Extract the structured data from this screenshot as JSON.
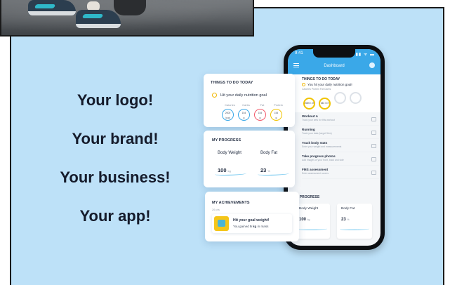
{
  "slogans": [
    "Your logo!",
    "Your brand!",
    "Your business!",
    "Your app!"
  ],
  "phone": {
    "time": "9:41",
    "status": "▮▮ ᯤ ▬",
    "title": "Dashboard",
    "todo": {
      "heading": "THINGS TO DO TODAY",
      "goal": "You hit your daily nutrition goal!",
      "legend": "Calories   Protein   Fat   Carbs",
      "rings": [
        "2000 / 47",
        "154 / 47",
        "",
        ""
      ]
    },
    "items": [
      {
        "title": "Workout A",
        "sub": "Track your sets for this workout"
      },
      {
        "title": "Running",
        "sub": "Track your data (target 5km)"
      },
      {
        "title": "Track body stats",
        "sub": "Enter your weight and measurements"
      },
      {
        "title": "Take progress photos",
        "sub": "Add images of your front, back and side"
      },
      {
        "title": "FMS assessment",
        "sub": "Enter assessment scores"
      }
    ],
    "progress_heading": "MY PROGRESS",
    "cards": [
      {
        "label": "Body Weight",
        "value": "100",
        "unit": "kg"
      },
      {
        "label": "Body Fat",
        "value": "23",
        "unit": "%"
      }
    ]
  },
  "todo_card": {
    "heading": "THINGS TO DO TODAY",
    "goal": "Hit your daily nutrition goal",
    "legend": [
      "Calories",
      "Carbs",
      "Fat",
      "Protein"
    ],
    "rings": [
      {
        "top": "2000",
        "bottom": "kcal"
      },
      {
        "top": "154",
        "bottom": "g"
      },
      {
        "top": "154",
        "bottom": "g"
      },
      {
        "top": "154",
        "bottom": "g"
      }
    ]
  },
  "progress_card": {
    "heading": "MY PROGRESS",
    "cards": [
      {
        "label": "Body Weight",
        "value": "100",
        "unit": "kg"
      },
      {
        "label": "Body Fat",
        "value": "23",
        "unit": "%"
      }
    ]
  },
  "achievements_card": {
    "heading": "MY ACHIEVEMENTS",
    "sub": "26 pts",
    "title": "Hit your goal weight!",
    "desc_pre": "You gained ",
    "desc_bold": "5 kg",
    "desc_post": " in mass"
  },
  "colors": {
    "panel_bg": "#bde1f8",
    "accent_blue": "#3aa8e8",
    "accent_yellow": "#f1c400",
    "accent_red": "#f25a6b",
    "text_dark": "#151b2b"
  }
}
